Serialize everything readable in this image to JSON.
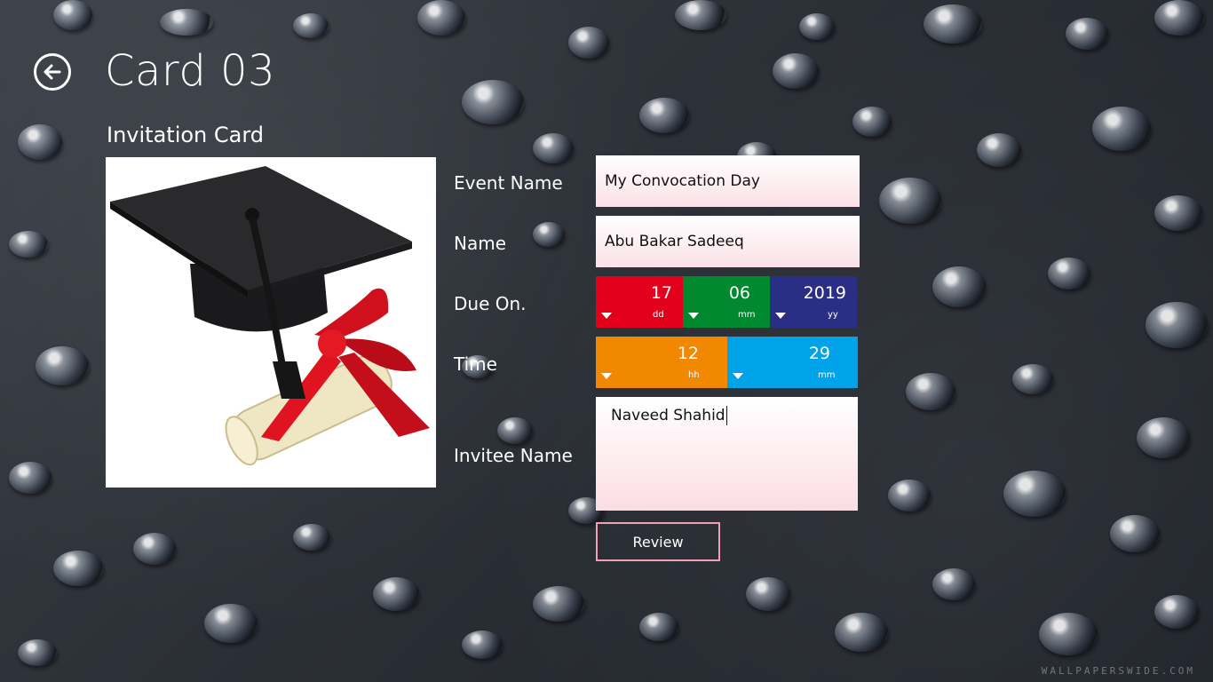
{
  "header": {
    "title": "Card 03",
    "subtitle": "Invitation Card"
  },
  "back_icon": "arrow-left-circle-icon",
  "image": {
    "icon": "graduation-cap-diploma-image"
  },
  "form": {
    "event_name": {
      "label": "Event Name",
      "value": "My Convocation Day"
    },
    "name": {
      "label": "Name",
      "value": "Abu Bakar Sadeeq"
    },
    "due_on": {
      "label": "Due On.",
      "day": {
        "value": "17",
        "unit": "dd",
        "color": "#e3001b"
      },
      "month": {
        "value": "06",
        "unit": "mm",
        "color": "#00892e"
      },
      "year": {
        "value": "2019",
        "unit": "yy",
        "color": "#2a2e85"
      }
    },
    "time": {
      "label": "Time",
      "hour": {
        "value": "12",
        "unit": "hh",
        "color": "#f28700"
      },
      "minute": {
        "value": "29",
        "unit": "mm",
        "color": "#00a2e8"
      }
    },
    "invitee": {
      "label": "Invitee Name",
      "value": "Naveed Shahid"
    }
  },
  "review_button": {
    "label": "Review",
    "border_color": "#f3a0b6"
  },
  "watermark": "WALLPAPERSWIDE.COM"
}
